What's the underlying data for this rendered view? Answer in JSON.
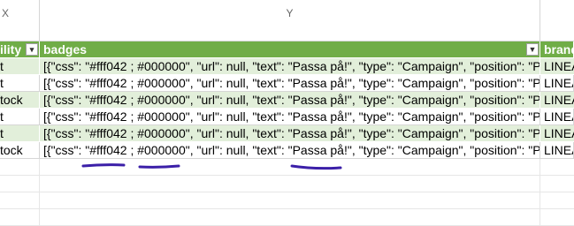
{
  "columns": {
    "x_letter": "X",
    "y_letter": "Y",
    "z_letter": ""
  },
  "header": {
    "x_label": "ility",
    "y_label": "badges",
    "z_label": "brand"
  },
  "rows": [
    {
      "x": "t",
      "y": "[{\"css\": \"#fff042 ; #000000\", \"url\": null, \"text\": \"Passa på!\", \"type\": \"Campaign\", \"position\": \"P",
      "z": "LINEA"
    },
    {
      "x": "t",
      "y": "[{\"css\": \"#fff042 ; #000000\", \"url\": null, \"text\": \"Passa på!\", \"type\": \"Campaign\", \"position\": \"P",
      "z": "LINEA"
    },
    {
      "x": "tock",
      "y": "[{\"css\": \"#fff042 ; #000000\", \"url\": null, \"text\": \"Passa på!\", \"type\": \"Campaign\", \"position\": \"P",
      "z": "LINEA"
    },
    {
      "x": "t",
      "y": "[{\"css\": \"#fff042 ; #000000\", \"url\": null, \"text\": \"Passa på!\", \"type\": \"Campaign\", \"position\": \"P",
      "z": "LINEA"
    },
    {
      "x": "t",
      "y": "[{\"css\": \"#fff042 ; #000000\", \"url\": null, \"text\": \"Passa på!\", \"type\": \"Campaign\", \"position\": \"P",
      "z": "LINEA"
    },
    {
      "x": "tock",
      "y": "[{\"css\": \"#fff042 ; #000000\", \"url\": null, \"text\": \"Passa på!\", \"type\": \"Campaign\", \"position\": \"P",
      "z": "LINEA"
    }
  ],
  "icons": {
    "filter_x": "dropdown-filter-icon",
    "filter_y": "active-filter-icon"
  },
  "colors": {
    "header_bg": "#70ad47",
    "band_bg": "#e2efda",
    "annotation": "#3b1fa8"
  }
}
